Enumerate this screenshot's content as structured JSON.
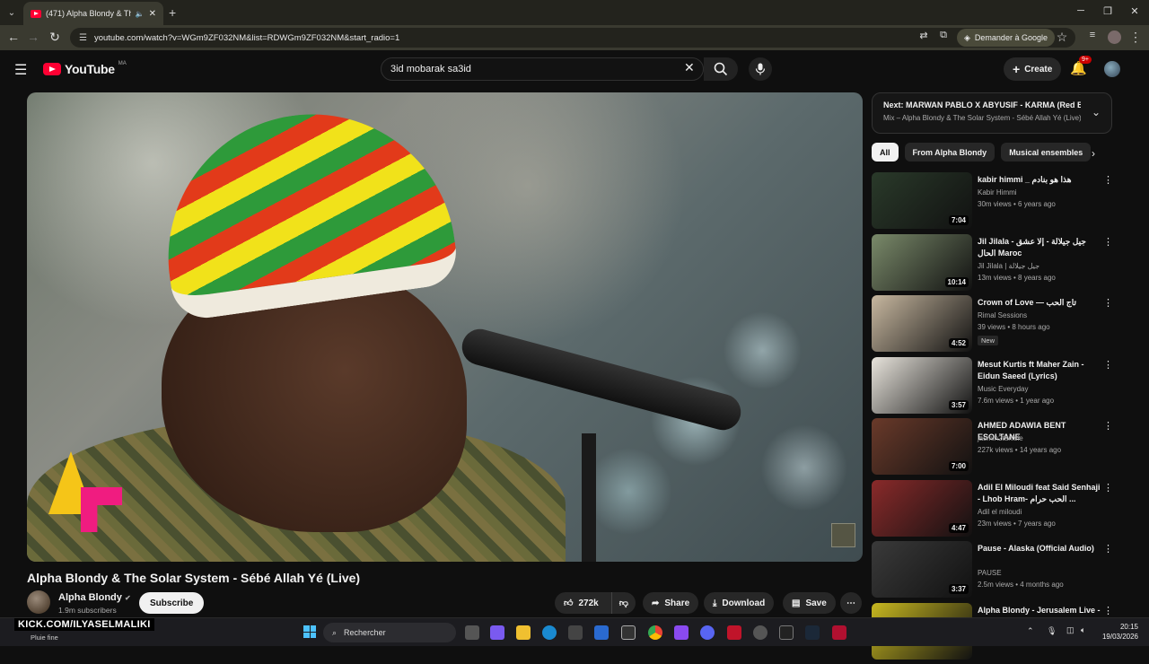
{
  "browser": {
    "tab_title": "(471) Alpha Blondy & The S",
    "url": "youtube.com/watch?v=WGm9ZF032NM&list=RDWGm9ZF032NM&start_radio=1",
    "google_button": "Demander à Google"
  },
  "yt_header": {
    "logo": "YouTube",
    "region": "MA",
    "search_value": "3id mobarak sa3id",
    "create_label": "Create",
    "notif_badge": "9+"
  },
  "video": {
    "title": "Alpha Blondy & The Solar System - Sébé Allah Yé (Live)",
    "channel": "Alpha Blondy",
    "subscribers": "1.9m subscribers",
    "subscribe_label": "Subscribe",
    "likes": "272k",
    "share_label": "Share",
    "download_label": "Download",
    "save_label": "Save"
  },
  "up_next": {
    "title": "Next: MARWAN PABLO X ABYUSIF - KARMA (Red B...",
    "subtitle": "Mix – Alpha Blondy & The Solar System - Sébé Allah Yé (Live)"
  },
  "chips": [
    "All",
    "From Alpha Blondy",
    "Musical ensembles"
  ],
  "recommendations": [
    {
      "title": "kabir himmi _ هذا هو بنادم",
      "channel": "Kabir Himmi",
      "meta": "30m views • 6 years ago",
      "duration": "7:04",
      "color": "#2a3a2a"
    },
    {
      "title": "Jil Jilala - جيل جيلالة - إلا عشق الحال Maroc",
      "channel": "Jil Jilala | جيل جيلالة",
      "meta": "13m views • 8 years ago",
      "duration": "10:14",
      "color": "#7a8a6a"
    },
    {
      "title": "Crown of Love — تاج الحب",
      "channel": "Rimal Sessions",
      "meta": "39 views • 8 hours ago",
      "duration": "4:52",
      "new": "New",
      "color": "#c8b8a0"
    },
    {
      "title": "Mesut Kurtis ft Maher Zain - Eidun Saeed (Lyrics)",
      "channel": "Music Everyday",
      "meta": "7.6m views • 1 year ago",
      "duration": "3:57",
      "color": "#e8e4dc"
    },
    {
      "title": "AHMED ADAWIA BENT ESOLTANE",
      "channel": "jasmin2tunisie",
      "meta": "227k views • 14 years ago",
      "duration": "7:00",
      "color": "#6a3a2a"
    },
    {
      "title": "Adil El Miloudi feat Said Senhaji - Lhob Hram- الحب حرام ...",
      "channel": "Adil el miloudi",
      "meta": "23m views • 7 years ago",
      "duration": "4:47",
      "color": "#8a2a2a"
    },
    {
      "title": "Pause - Alaska (Official Audio)",
      "channel": "PAUSE",
      "meta": "2.5m views • 4 months ago",
      "duration": "3:37",
      "color": "#3a3a3a"
    },
    {
      "title": "Alpha Blondy - Jerusalem Live -",
      "channel": "",
      "meta": "",
      "duration": "",
      "color": "#c8b820"
    }
  ],
  "taskbar": {
    "weather": "Pluie fine",
    "kick": "KICK.COM/ILYASELMALIKI",
    "search": "Rechercher",
    "time": "20:15",
    "date": "19/03/2026"
  }
}
